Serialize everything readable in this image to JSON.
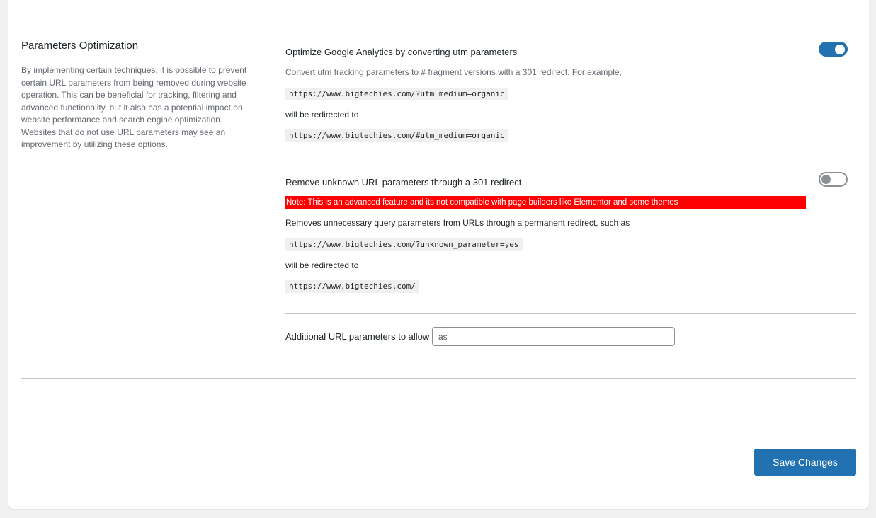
{
  "section": {
    "title": "Parameters Optimization",
    "description": "By implementing certain techniques, it is possible to prevent certain URL parameters from being removed during website operation. This can be beneficial for tracking, filtering and advanced functionality, but it also has a potential impact on website performance and search engine optimization. Websites that do not use URL parameters may see an improvement by utilizing these options."
  },
  "option_utm": {
    "title": "Optimize Google Analytics by converting utm parameters",
    "enabled": true,
    "description": "Convert utm tracking parameters to # fragment versions with a 301 redirect. For example,",
    "example_from": "https://www.bigtechies.com/?utm_medium=organic",
    "redirect_text": "will be redirected to",
    "example_to": "https://www.bigtechies.com/#utm_medium=organic"
  },
  "option_unknown": {
    "title": "Remove unknown URL parameters through a 301 redirect",
    "enabled": false,
    "warning": "Note: This is an advanced feature and its not compatible with page builders like Elementor and some themes",
    "description": "Removes unnecessary query parameters from URLs through a permanent redirect, such as",
    "example_from": "https://www.bigtechies.com/?unknown_parameter=yes",
    "redirect_text": "will be redirected to",
    "example_to": "https://www.bigtechies.com/"
  },
  "allow_params": {
    "label": "Additional URL parameters to allow",
    "value": "as"
  },
  "save_button": {
    "label": "Save Changes"
  },
  "colors": {
    "accent": "#2271b1",
    "warning_bg": "#ff0000"
  }
}
